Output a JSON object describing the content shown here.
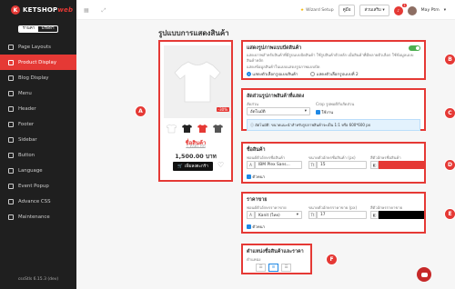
{
  "app": {
    "logo_text": "KETSHOP",
    "logo_accent": "web"
  },
  "sidebar": {
    "mode_toggle": {
      "option_a": "ร้านค้า",
      "option_b": "บริษัทฯ"
    },
    "items": [
      {
        "label": "Page Layouts"
      },
      {
        "label": "Product Display"
      },
      {
        "label": "Blog Display"
      },
      {
        "label": "Menu"
      },
      {
        "label": "Header"
      },
      {
        "label": "Footer"
      },
      {
        "label": "Sidebar"
      },
      {
        "label": "Button"
      },
      {
        "label": "Language"
      },
      {
        "label": "Event Popup"
      },
      {
        "label": "Advance CSS"
      },
      {
        "label": "Maintenance"
      }
    ],
    "active_index": 1,
    "version": "cssStls 6.15.3 (dev)"
  },
  "topbar": {
    "wizard_label": "Wizard Setup",
    "plan_button": "คู่มือ",
    "store_select": "ส่วนเสริม",
    "notif_count": "1",
    "user_name": "May Ptm"
  },
  "page": {
    "title": "รูปแบบการแสดงสินค้า"
  },
  "preview": {
    "sale_badge": "-30%",
    "product_name": "ชื่อสินค้า",
    "old_price": "1,690.00",
    "new_price": "1,500.00 บาท",
    "cart_button": "เพิ่มลงตะกร้า"
  },
  "section_b": {
    "title": "แสดงรูปภาพแบบปัดสินค้า",
    "desc": "แสดงภาพสำหรับสินค้าที่มีรูปแบบปัดสินค้า ใช้รูปสินค้าตัวหลัก เมื่อสินค้าที่มีหลายตัวเลือก ใช้ข้อมูลแบบสินค้าหลัก",
    "desc2": "แสดงข้อมูลสินค้าในแบบแสดงรูปภาพแบบปัด",
    "option1": "แสดงตัวเลือกรูปแบบสินค้า",
    "option2": "แสดงตัวเลือกรูปแบบที่ 2"
  },
  "section_c": {
    "title": "สัดส่วนรูปภาพสินค้าที่แสดง",
    "ratio_label": "สัดส่วน",
    "ratio_value": "อัตโนมัติ",
    "crop_label": "Crop รูปพอดีกับสัดส่วน",
    "crop_value": "ใช้งาน",
    "info": "อัตโนมัติ: ขนาดแนะนำสำหรับรูปภาพสินค้าจะเป็น 1:1 หรือ 600*600 px"
  },
  "section_d": {
    "title": "ชื่อสินค้า",
    "font_label": "ฟอนต์ตัวอักษรชื่อสินค้า",
    "font_value": "IBM Plex Sans...",
    "size_label": "ขนาดตัวอักษรชื่อสินค้า (px)",
    "size_value": "15",
    "color_label": "สีตัวอักษรชื่อสินค้า",
    "color_hex": "#e53935",
    "bold_label": "ตัวหนา"
  },
  "section_e": {
    "title": "ราคาขาย",
    "font_label": "ฟอนต์ตัวอักษรราคาขาย",
    "font_value": "Kanit (ไทย)",
    "size_label": "ขนาดตัวอักษรราคาขาย (px)",
    "size_value": "17",
    "color_label": "สีตัวอักษรราคาขาย",
    "color_hex": "#000000",
    "bold_label": "ตัวหนา"
  },
  "section_f": {
    "title": "ตำแหน่งชื่อสินค้าและราคา",
    "align_label": "ตำแหน่ง",
    "active_align": "center"
  },
  "markers": [
    "A",
    "B",
    "C",
    "D",
    "E",
    "F"
  ],
  "colors": {
    "accent": "#e53935",
    "sidebar_bg": "#1f1f1f",
    "switch_on": "#4caf50"
  }
}
